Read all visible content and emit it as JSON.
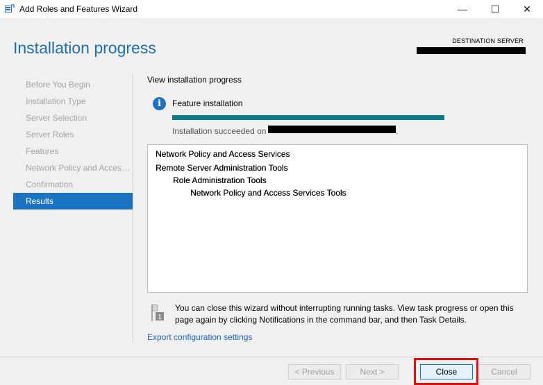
{
  "window": {
    "title": "Add Roles and Features Wizard",
    "minimize_glyph": "—",
    "maximize_glyph": "☐",
    "close_glyph": "✕"
  },
  "header": {
    "page_title": "Installation progress",
    "destination_label": "DESTINATION SERVER"
  },
  "nav": {
    "items": [
      {
        "label": "Before You Begin",
        "state": "inactive"
      },
      {
        "label": "Installation Type",
        "state": "inactive"
      },
      {
        "label": "Server Selection",
        "state": "inactive"
      },
      {
        "label": "Server Roles",
        "state": "inactive"
      },
      {
        "label": "Features",
        "state": "inactive"
      },
      {
        "label": "Network Policy and Access Ser...",
        "state": "inactive"
      },
      {
        "label": "Confirmation",
        "state": "inactive"
      },
      {
        "label": "Results",
        "state": "active"
      }
    ]
  },
  "main": {
    "section_title": "View installation progress",
    "status": {
      "icon": "info-icon",
      "icon_glyph": "i",
      "label": "Feature installation",
      "progress": 1.0,
      "progress_color": "#0f7b8f",
      "success_text": "Installation succeeded on",
      "success_suffix": "."
    },
    "results_tree": [
      {
        "label": "Network Policy and Access Services",
        "level": 0
      },
      {
        "label": "Remote Server Administration Tools",
        "level": 0
      },
      {
        "label": "Role Administration Tools",
        "level": 1
      },
      {
        "label": "Network Policy and Access Services Tools",
        "level": 2
      }
    ],
    "note": {
      "icon": "flag-notification-icon",
      "badge": "1",
      "text": "You can close this wizard without interrupting running tasks. View task progress or open this page again by clicking Notifications in the command bar, and then Task Details."
    },
    "export_link": "Export configuration settings"
  },
  "footer": {
    "previous_label": "< Previous",
    "next_label": "Next >",
    "close_label": "Close",
    "cancel_label": "Cancel"
  },
  "colors": {
    "accent": "#1c74c0",
    "title_blue": "#1e6fa8",
    "highlight_red": "#e01010"
  }
}
